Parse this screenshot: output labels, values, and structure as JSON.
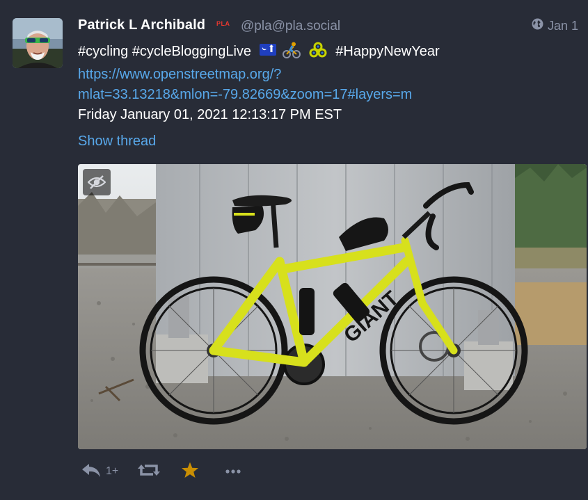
{
  "status": {
    "account": {
      "display_name": "Patrick L Archibald",
      "badge": "PLA",
      "handle": "@pla@pla.social"
    },
    "visibility_icon": "globe-icon",
    "timestamp": "Jan 1",
    "content": {
      "hashtags_line": "#cycling #cycleBloggingLive",
      "emojis": [
        "south-carolina-flag-emoji",
        "cyclist-emoji",
        "bike-chain-emoji"
      ],
      "hashtag_new_year": "#HappyNewYear",
      "link_line1": "https://www.openstreetmap.org/?",
      "link_line2": "mlat=33.13218&mlon=-79.82669&zoom=17#layers=m",
      "date_line": "Friday January 01, 2021 12:13:17 PM EST"
    },
    "show_thread": "Show thread",
    "media": {
      "hide_icon": "eye-slash-icon",
      "bike_brand": "GIANT"
    },
    "actions": {
      "reply_icon": "reply-icon",
      "reply_count": "1+",
      "boost_icon": "retweet-icon",
      "favourite_icon": "star-icon",
      "favourite_color": "#ca8f04",
      "more_icon": "ellipsis-icon"
    }
  }
}
